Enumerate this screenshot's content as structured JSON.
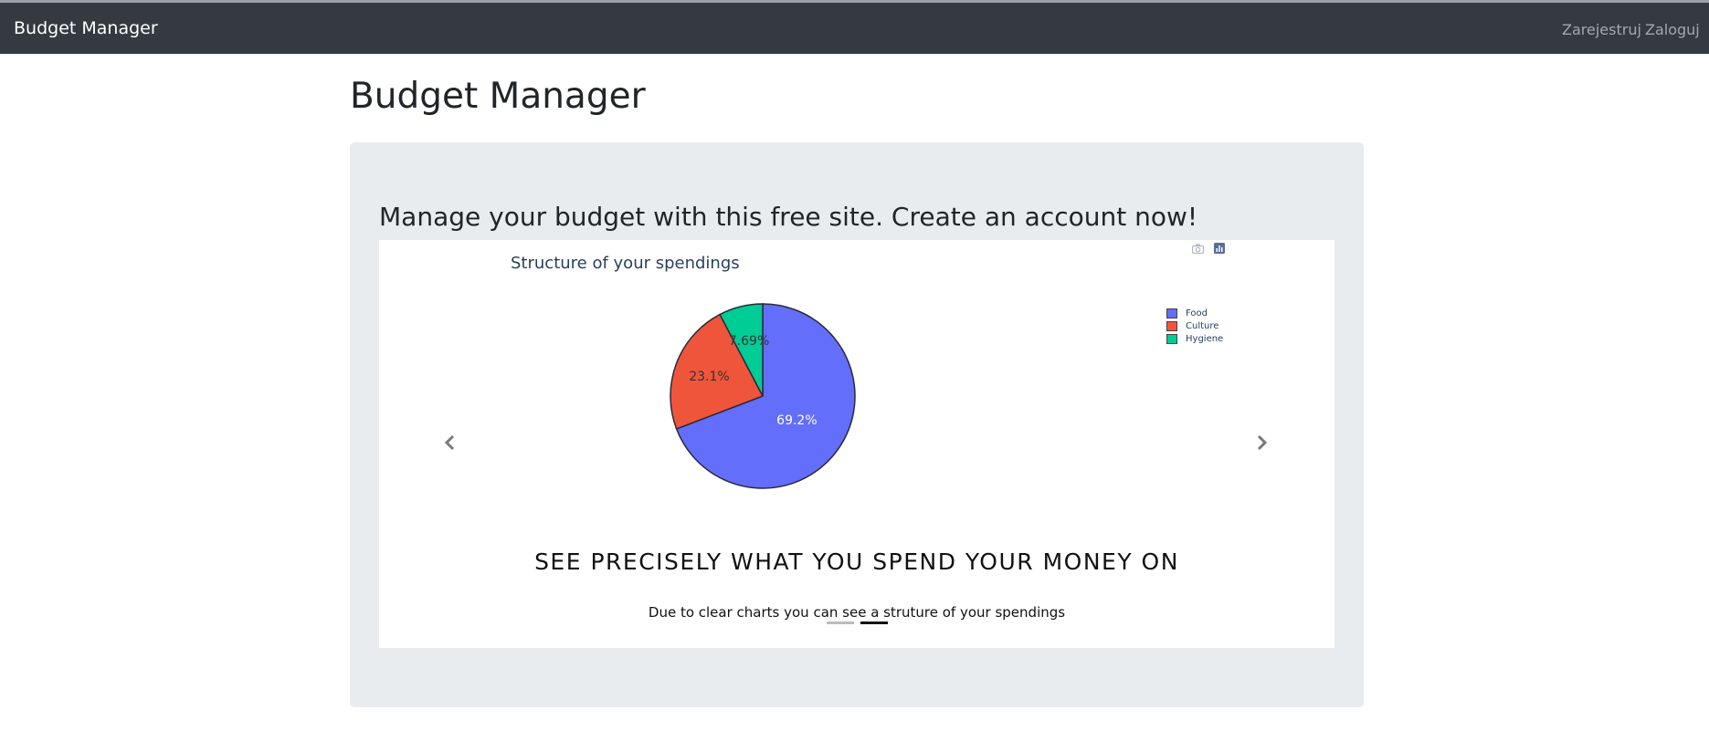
{
  "navbar": {
    "brand": "Budget Manager",
    "links": [
      {
        "label": "Zarejestruj"
      },
      {
        "label": "Zaloguj"
      }
    ]
  },
  "page": {
    "title": "Budget Manager"
  },
  "jumbotron": {
    "heading": "Manage your budget with this free site. Create an account now!"
  },
  "carousel": {
    "caption_heading": "SEE PRECISELY WHAT YOU SPEND YOUR MONEY ON",
    "caption_text": "Due to clear charts you can see a struture of your spendings",
    "prev_icon": "chevron-left-icon",
    "next_icon": "chevron-right-icon",
    "indicators": [
      {
        "active": false
      },
      {
        "active": true
      }
    ]
  },
  "modebar": {
    "icons": [
      "camera-icon",
      "plotly-logo-icon"
    ]
  },
  "chart_data": {
    "type": "pie",
    "title": "Structure of your spendings",
    "labels": [
      "Food",
      "Culture",
      "Hygiene"
    ],
    "values": [
      69.2,
      23.1,
      7.69
    ],
    "value_labels": [
      "69.2%",
      "23.1%",
      "7.69%"
    ],
    "colors": [
      "#636efa",
      "#ef553b",
      "#00cc96"
    ],
    "legend_position": "top-right"
  }
}
